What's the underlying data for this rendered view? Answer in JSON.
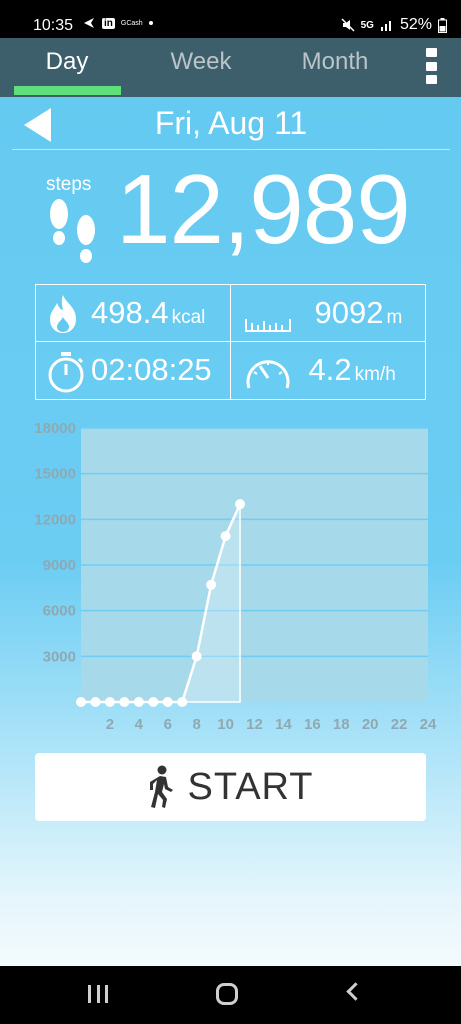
{
  "status_bar": {
    "time": "10:35",
    "battery_percent": "52%",
    "notification_text": "GCash",
    "signal_label": "5G"
  },
  "tabs": [
    {
      "label": "Day",
      "active": true
    },
    {
      "label": "Week",
      "active": false
    },
    {
      "label": "Month",
      "active": false
    }
  ],
  "date_nav": {
    "date": "Fri, Aug 11"
  },
  "steps": {
    "label": "steps",
    "value": "12,989"
  },
  "stats": {
    "calories": {
      "value": "498.4",
      "unit": "kcal"
    },
    "distance": {
      "value": "9092",
      "unit": "m"
    },
    "duration": {
      "value": "02:08:25"
    },
    "speed": {
      "value": "4.2",
      "unit": "km/h"
    }
  },
  "chart_data": {
    "type": "area",
    "x": [
      0,
      1,
      2,
      3,
      4,
      5,
      6,
      7,
      8,
      9,
      10,
      11
    ],
    "values": [
      0,
      0,
      0,
      0,
      0,
      0,
      0,
      0,
      3000,
      7700,
      10900,
      13000
    ],
    "xlim": [
      0,
      24
    ],
    "ylim": [
      0,
      18000
    ],
    "xticks": [
      "2",
      "4",
      "6",
      "8",
      "10",
      "12",
      "14",
      "16",
      "18",
      "20",
      "22",
      "24"
    ],
    "yticks": [
      "3000",
      "6000",
      "9000",
      "12000",
      "15000",
      "18000"
    ],
    "grid": true,
    "colors": {
      "line": "#ffffff",
      "plot_bg": "#a6d9ea",
      "grid": "#6fcdf3",
      "ticks": "#8fa9b3"
    }
  },
  "start_button": {
    "label": "START"
  },
  "colors": {
    "accent": "#5fe07a",
    "tab_bar": "#3d5e6b",
    "background": "#63c9f0"
  }
}
